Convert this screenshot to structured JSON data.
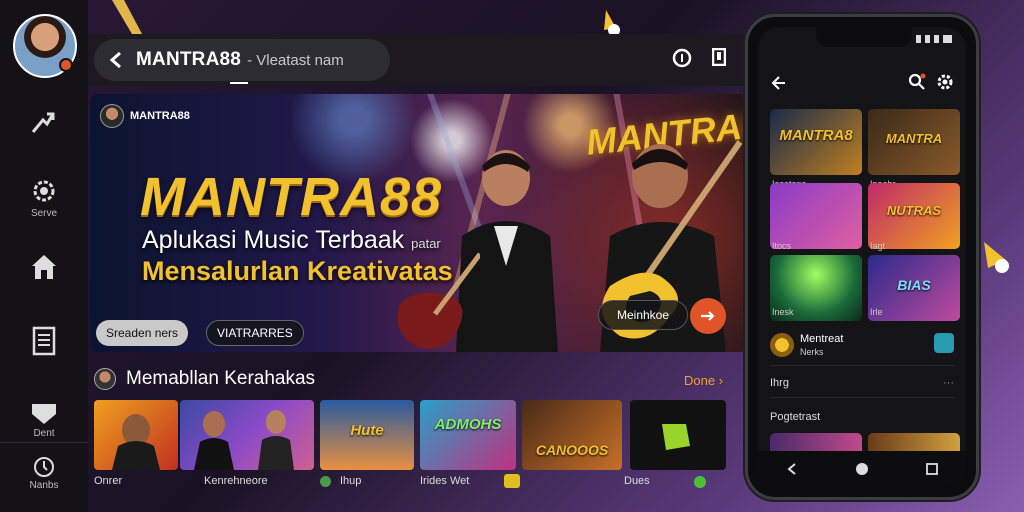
{
  "rail": {
    "items": [
      {
        "label": ""
      },
      {
        "label": "Serve"
      },
      {
        "label": ""
      },
      {
        "label": ""
      },
      {
        "label": "Dent"
      },
      {
        "label": "Nanbs"
      }
    ]
  },
  "topbar": {
    "title": "MANTRA88",
    "subtitle": "- Vleatast nam"
  },
  "hero": {
    "mini_label": "MANTRA88",
    "logo": "MANTRA88",
    "logo_secondary": "MANTRAIS",
    "tagline": "Aplukasi Music Terbaak",
    "tagline_small": "patar",
    "tagline_accent": "Mensalurlan Kreativatas",
    "chip_primary": "Sreaden ners",
    "chip_secondary": "VIATRARRES",
    "cta_label": "Meinhkoe"
  },
  "section": {
    "title": "Memabllan Kerahakas",
    "done_label": "Done",
    "cards": [
      {
        "label": "Onrer",
        "word": ""
      },
      {
        "label": "Kenrehneore",
        "word": ""
      },
      {
        "label": "Ihup",
        "word": "Hute"
      },
      {
        "label": "Irides Wet",
        "word": "ADMOHS"
      },
      {
        "label": "",
        "word": "CANOOOS"
      },
      {
        "label": "Dues",
        "word": ""
      }
    ]
  },
  "phone": {
    "grid": [
      {
        "label": "Iasetene",
        "word": "MANTRA8"
      },
      {
        "label": "Ipeobr",
        "word": "MANTRA"
      },
      {
        "label": "Itocs",
        "word": ""
      },
      {
        "label": "Iagt",
        "word": "NUTRAS"
      },
      {
        "label": "Inesk",
        "word": ""
      },
      {
        "label": "Irle",
        "word": "BIAS"
      }
    ],
    "profile_name": "Mentreat",
    "profile_sub": "Nerks",
    "list": [
      {
        "label": "Ihrg"
      },
      {
        "label": "Pogtetrast"
      }
    ]
  },
  "colors": {
    "accent": "#f2c12e",
    "brand_orange": "#e0542a",
    "rail_bg": "#141216"
  }
}
